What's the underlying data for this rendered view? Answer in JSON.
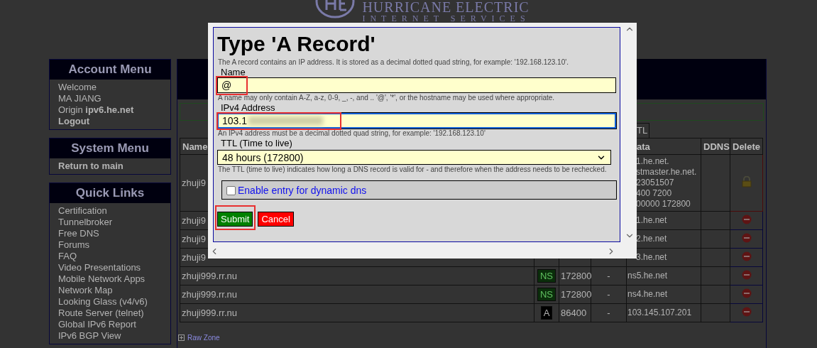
{
  "logo": {
    "line_1": "HURRICANE ELECTRIC",
    "line_2": "INTERNET SERVICES"
  },
  "menus": [
    {
      "title": "Account Menu",
      "items": [
        "Welcome",
        "MA JIANG",
        "Origin **ipv6.he.net**",
        "**Logout**"
      ]
    },
    {
      "title": "System Menu",
      "items": [
        "**Return to main**"
      ]
    },
    {
      "title": "Quick Links",
      "items": [
        "Certification",
        "Tunnelbroker",
        "Free DNS",
        "Forums",
        "FAQ",
        "Video Presentations",
        "Mobile Network Apps",
        "Network Map",
        "Looking Glass (v4/v6)",
        "Route Server (telnet)",
        "Global IPv6 Report",
        "IPv6 BGP View"
      ]
    }
  ],
  "zone": {
    "tabs": [
      {
        "label": "TL"
      }
    ],
    "table": {
      "columns": [
        {
          "label": "Name"
        },
        {},
        {},
        {},
        {
          "label": "ata"
        },
        {
          "label": "DDNS"
        },
        {
          "label": "Delete"
        }
      ],
      "rows": [
        {
          "name": "zhuji9",
          "data": [
            "1.he.net.",
            "stmaster.he.net.",
            "23051507",
            "400 7200",
            "00000 172800"
          ],
          "locked": true
        },
        {
          "name": "zhuji9",
          "data": [
            "1.he.net"
          ],
          "locked": false
        },
        {
          "name": "zhuji9",
          "data": [
            "2.he.net"
          ],
          "locked": false
        },
        {
          "name": "zhuji9",
          "data": [
            "3.he.net"
          ],
          "locked": false
        },
        {
          "name": "zhuji999.rr.nu",
          "type": {
            "label": "NS",
            "color": "#0b2e0b"
          },
          "ttl": "172800",
          "priority": "-",
          "data": [
            "ns5.he.net"
          ],
          "locked": false
        },
        {
          "name": "zhuji999.rr.nu",
          "type": {
            "label": "NS",
            "color": "#0b2e0b"
          },
          "ttl": "172800",
          "priority": "-",
          "data": [
            "ns4.he.net"
          ],
          "locked": false
        },
        {
          "name": "zhuji999.rr.nu",
          "type": {
            "label": "A",
            "color": "#000000"
          },
          "ttl": "86400",
          "priority": "-",
          "data": [
            "103.145.107.201"
          ],
          "locked": false
        }
      ]
    },
    "raw_zone_link": "Raw Zone"
  },
  "dialog": {
    "title": "Type 'A Record'",
    "description": "The A record contains an IP address. It is stored as a decimal dotted quad string, for example: '192.168.123.10'.",
    "fields": [
      {
        "kind": "text",
        "label": "Name",
        "value": "@",
        "focused": false,
        "redacted": false,
        "highlighted": true,
        "hint": "A name may only contain A-Z, a-z, 0-9, _, -, and .. '@', '*', or the hostname may be used where appropriate."
      },
      {
        "kind": "text",
        "label": "IPv4 Address",
        "value": "103.1",
        "focused": true,
        "redacted": true,
        "highlighted": true,
        "hint": "An IPv4 address must be a decimal dotted quad string, for example: '192.168.123.10'"
      },
      {
        "kind": "select",
        "label": "TTL (Time to live)",
        "value": "48 hours (172800)",
        "hint": "The TTL (time to live) indicates how long a DNS record is valid for - and therefore when the address needs to be rechecked."
      }
    ],
    "dynamic_dns": {
      "label": "Enable entry for dynamic dns",
      "checked": false
    },
    "buttons": [
      {
        "label": "Submit",
        "kind": "submit",
        "highlighted": true
      },
      {
        "label": "Cancel",
        "kind": "cancel",
        "highlighted": false
      }
    ]
  }
}
